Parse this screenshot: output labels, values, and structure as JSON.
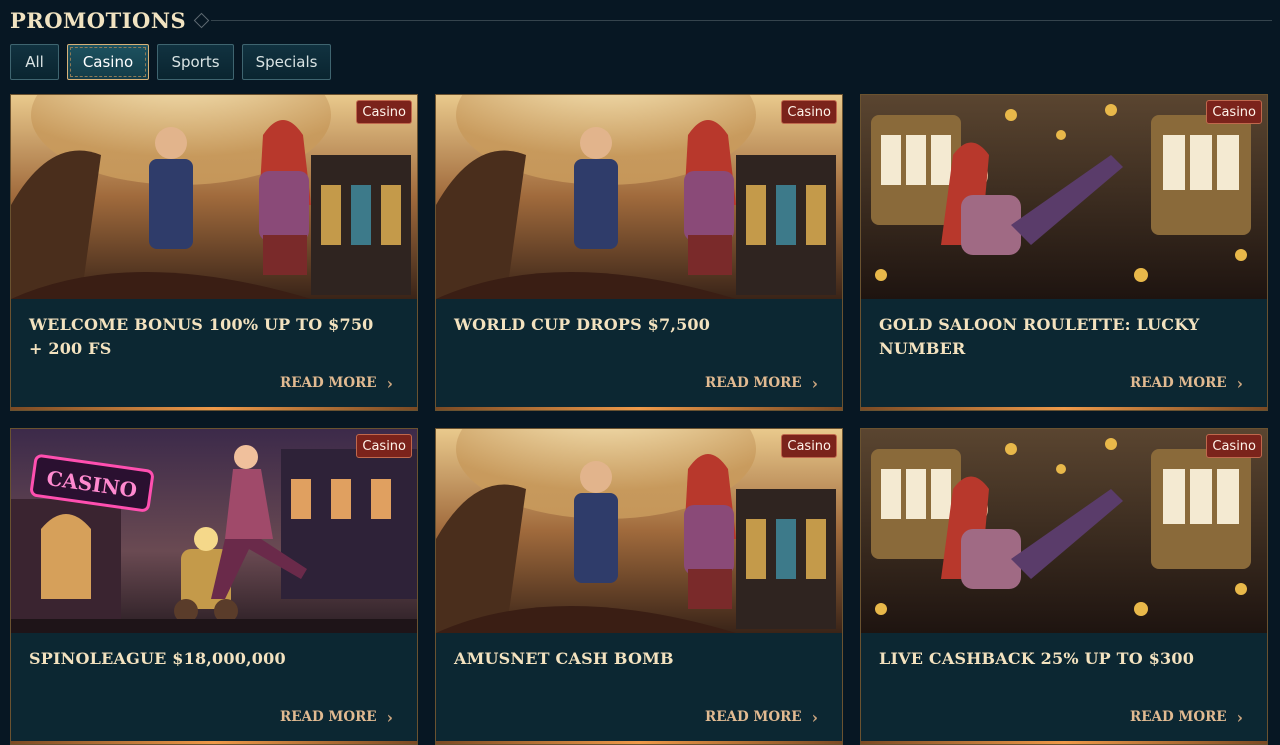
{
  "page": {
    "title": "PROMOTIONS"
  },
  "tabs": [
    {
      "label": "All",
      "active": false
    },
    {
      "label": "Casino",
      "active": true
    },
    {
      "label": "Sports",
      "active": false
    },
    {
      "label": "Specials",
      "active": false
    }
  ],
  "cards": [
    {
      "badge": "Casino",
      "title": "WELCOME BONUS 100% UP TO $750 + 200 FS",
      "cta": "READ MORE",
      "image": "steampunk-couple-roulette"
    },
    {
      "badge": "Casino",
      "title": "WORLD CUP DROPS $7,500",
      "cta": "READ MORE",
      "image": "steampunk-couple-roulette"
    },
    {
      "badge": "Casino",
      "title": "GOLD SALOON ROULETTE: LUCKY NUMBER",
      "cta": "READ MORE",
      "image": "girl-slot-machines-coins"
    },
    {
      "badge": "Casino",
      "title": "SPINOLEAGUE $18,000,000",
      "cta": "READ MORE",
      "image": "casino-street-robot"
    },
    {
      "badge": "Casino",
      "title": "AMUSNET CASH BOMB",
      "cta": "READ MORE",
      "image": "steampunk-couple-roulette"
    },
    {
      "badge": "Casino",
      "title": "LIVE CASHBACK 25% UP TO $300",
      "cta": "READ MORE",
      "image": "girl-slot-machines-coins"
    }
  ],
  "images": {
    "casino_sign": "CASINO"
  },
  "colors": {
    "background": "#071723",
    "card": "#0c2732",
    "badge": "#7b231b",
    "accent": "#e1ba91",
    "title": "#f3e2bf"
  },
  "icons": {
    "read_more": "chevron-right-icon"
  }
}
